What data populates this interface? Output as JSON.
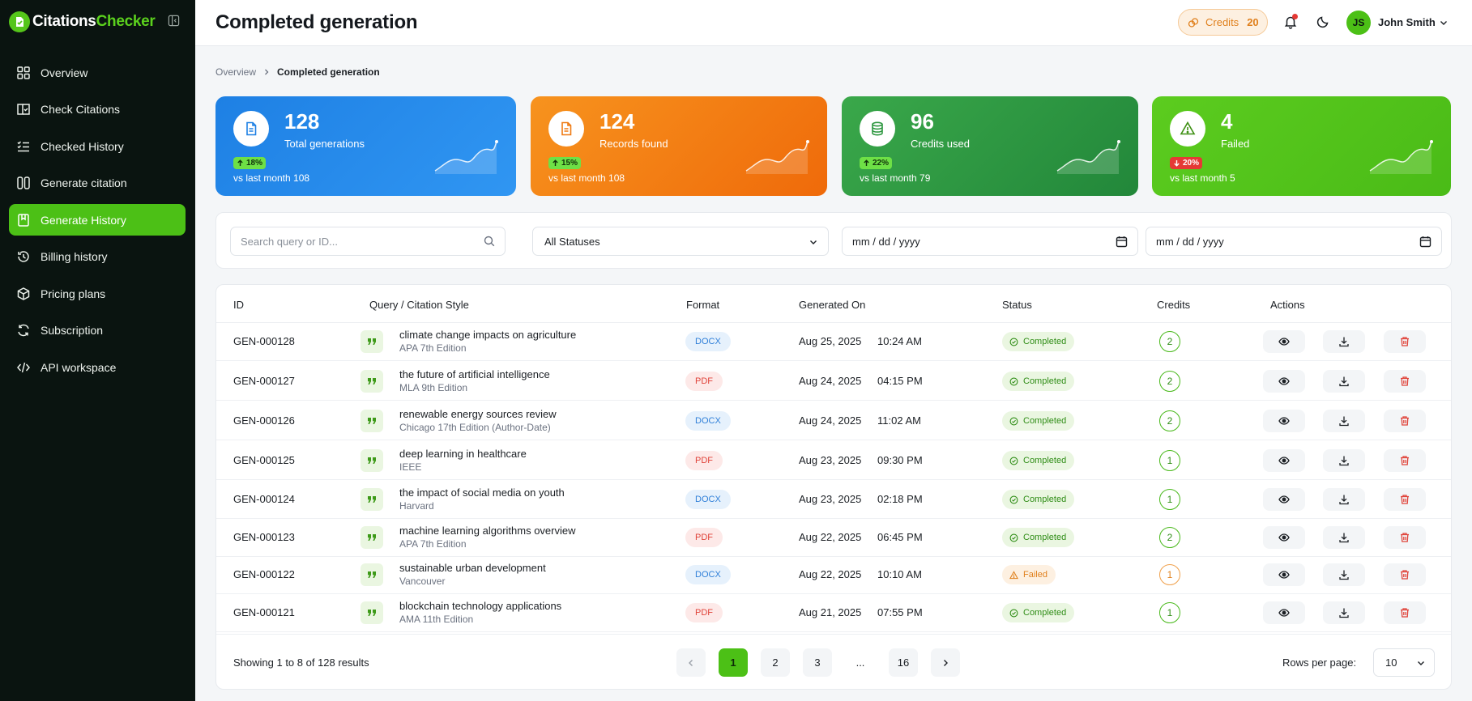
{
  "brand": {
    "name_a": "Citations",
    "name_b": "Checker"
  },
  "sidebar": {
    "items": [
      {
        "label": "Overview",
        "icon": "grid-icon"
      },
      {
        "label": "Check Citations",
        "icon": "book-check-icon"
      },
      {
        "label": "Checked History",
        "icon": "list-check-icon"
      },
      {
        "label": "Generate citation",
        "icon": "quote-icon"
      },
      {
        "label": "Generate History",
        "icon": "bookmark-icon",
        "active": true
      },
      {
        "label": "Billing history",
        "icon": "history-icon"
      },
      {
        "label": "Pricing plans",
        "icon": "package-icon"
      },
      {
        "label": "Subscription",
        "icon": "refresh-icon"
      },
      {
        "label": "API workspace",
        "icon": "code-icon"
      }
    ]
  },
  "header": {
    "title": "Completed generation",
    "credits_label": "Credits",
    "credits_value": "20",
    "avatar_initials": "JS",
    "user_name": "John Smith"
  },
  "breadcrumb": {
    "parent": "Overview",
    "current": "Completed generation"
  },
  "stats": [
    {
      "value": "128",
      "label": "Total generations",
      "badge": "18%",
      "trend": "up",
      "compare": "vs last month 108"
    },
    {
      "value": "124",
      "label": "Records found",
      "badge": "15%",
      "trend": "up",
      "compare": "vs last month 108"
    },
    {
      "value": "96",
      "label": "Credits used",
      "badge": "22%",
      "trend": "up",
      "compare": "vs last month 79"
    },
    {
      "value": "4",
      "label": "Failed",
      "badge": "20%",
      "trend": "down",
      "compare": "vs last month 5"
    }
  ],
  "colors": {
    "accent": "#4cc016",
    "card_blue": "#1e80e4",
    "card_orange": "#f27a0c",
    "card_green": "#2d9740",
    "card_lime": "#5ccc1f"
  },
  "filters": {
    "search_placeholder": "Search query or ID...",
    "status_selected": "All Statuses",
    "date_from": "mm / dd / yyyy",
    "date_to": "mm / dd / yyyy"
  },
  "table": {
    "headers": [
      "ID",
      "Query / Citation Style",
      "Format",
      "Generated On",
      "Status",
      "Credits",
      "Actions"
    ],
    "rows": [
      {
        "id": "GEN-000128",
        "query": "climate change impacts on agriculture",
        "style": "APA 7th Edition",
        "format": "DOCX",
        "date": "Aug 25, 2025",
        "time": "10:24 AM",
        "status": "Completed",
        "credits": "2"
      },
      {
        "id": "GEN-000127",
        "query": "the future of artificial intelligence",
        "style": "MLA 9th Edition",
        "format": "PDF",
        "date": "Aug 24, 2025",
        "time": "04:15 PM",
        "status": "Completed",
        "credits": "2"
      },
      {
        "id": "GEN-000126",
        "query": "renewable energy sources review",
        "style": "Chicago 17th Edition (Author-Date)",
        "format": "DOCX",
        "date": "Aug 24, 2025",
        "time": "11:02 AM",
        "status": "Completed",
        "credits": "2"
      },
      {
        "id": "GEN-000125",
        "query": "deep learning in healthcare",
        "style": "IEEE",
        "format": "PDF",
        "date": "Aug 23, 2025",
        "time": "09:30 PM",
        "status": "Completed",
        "credits": "1"
      },
      {
        "id": "GEN-000124",
        "query": "the impact of social media on youth",
        "style": "Harvard",
        "format": "DOCX",
        "date": "Aug 23, 2025",
        "time": "02:18 PM",
        "status": "Completed",
        "credits": "1"
      },
      {
        "id": "GEN-000123",
        "query": "machine learning algorithms overview",
        "style": "APA 7th Edition",
        "format": "PDF",
        "date": "Aug 22, 2025",
        "time": "06:45 PM",
        "status": "Completed",
        "credits": "2"
      },
      {
        "id": "GEN-000122",
        "query": "sustainable urban development",
        "style": "Vancouver",
        "format": "DOCX",
        "date": "Aug 22, 2025",
        "time": "10:10 AM",
        "status": "Failed",
        "credits": "1"
      },
      {
        "id": "GEN-000121",
        "query": "blockchain technology applications",
        "style": "AMA 11th Edition",
        "format": "PDF",
        "date": "Aug 21, 2025",
        "time": "07:55 PM",
        "status": "Completed",
        "credits": "1"
      }
    ]
  },
  "pagination": {
    "showing": "Showing 1 to 8 of 128 results",
    "pages": [
      "1",
      "2",
      "3",
      "...",
      "16"
    ],
    "current": "1",
    "rows_per_page_label": "Rows per page:",
    "rows_per_page_value": "10"
  }
}
